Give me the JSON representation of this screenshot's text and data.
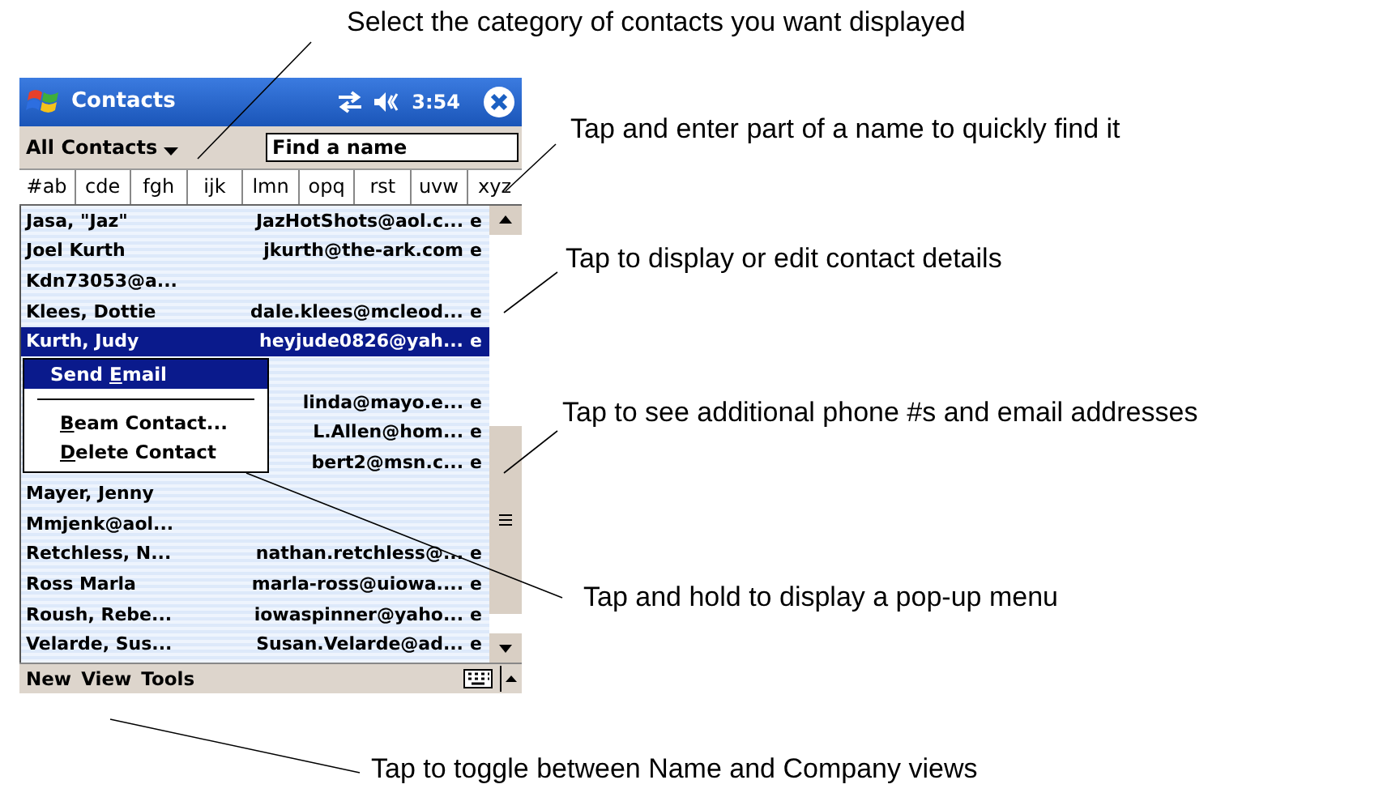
{
  "callouts": [
    {
      "kind": "top",
      "text": "Select the category of contacts you want displayed"
    },
    {
      "kind": "find",
      "text": "Tap and enter part of a name to quickly find it"
    },
    {
      "kind": "details",
      "text": "Tap to display or edit contact details"
    },
    {
      "kind": "more",
      "text": "Tap to see additional phone #s and email addresses"
    },
    {
      "kind": "hold",
      "text": "Tap and hold to display a pop-up menu"
    },
    {
      "kind": "bottom",
      "text": "Tap to toggle between Name and Company views"
    }
  ],
  "device": {
    "title_bar": {
      "title": "Contacts",
      "time": "3:54"
    },
    "category": {
      "label": "All Contacts",
      "find_placeholder": "Find a name"
    },
    "letter_tabs": [
      "#ab",
      "cde",
      "fgh",
      "ijk",
      "lmn",
      "opq",
      "rst",
      "uvw",
      "xyz"
    ],
    "rows": [
      {
        "name": "Jasa, \"Jaz\"",
        "email": "JazHotShots@aol.c...",
        "indicator": "e",
        "selected": false
      },
      {
        "name": "Joel Kurth",
        "email": "jkurth@the-ark.com",
        "indicator": "e",
        "selected": false
      },
      {
        "name": "Kdn73053@a...",
        "selected": false
      },
      {
        "name": "Klees, Dottie",
        "email": "dale.klees@mcleod...",
        "indicator": "e",
        "selected": false
      },
      {
        "name": "Kurth, Judy",
        "email": "heyjude0826@yah...",
        "indicator": "e",
        "selected": true
      },
      {
        "selected": false
      },
      {
        "email": "linda@mayo.e...",
        "indicator": "e",
        "selected": false
      },
      {
        "email": "L.Allen@hom...",
        "indicator": "e",
        "selected": false
      },
      {
        "email": "bert2@msn.c...",
        "indicator": "e",
        "selected": false
      },
      {
        "name": "Mayer, Jenny",
        "selected": false
      },
      {
        "name": "Mmjenk@aol...",
        "selected": false
      },
      {
        "name": "Retchless, N...",
        "email": "nathan.retchless@...",
        "indicator": "e",
        "selected": false
      },
      {
        "name": "Ross Marla",
        "email": "marla-ross@uiowa....",
        "indicator": "e",
        "selected": false
      },
      {
        "name": "Roush, Rebe...",
        "email": "iowaspinner@yaho...",
        "indicator": "e",
        "selected": false
      },
      {
        "name": "Velarde, Sus...",
        "email": "Susan.Velarde@ad...",
        "indicator": "e",
        "selected": false
      }
    ],
    "popup_menu": [
      {
        "kind": "item",
        "before": "Send ",
        "key": "E",
        "after": "mail",
        "selected": true
      },
      {
        "kind": "separator"
      },
      {
        "kind": "item",
        "key": "B",
        "after": "eam Contact...",
        "selected": false
      },
      {
        "kind": "item",
        "key": "D",
        "after": "elete Contact",
        "selected": false
      }
    ],
    "menu_bar": [
      "New",
      "View",
      "Tools"
    ]
  }
}
